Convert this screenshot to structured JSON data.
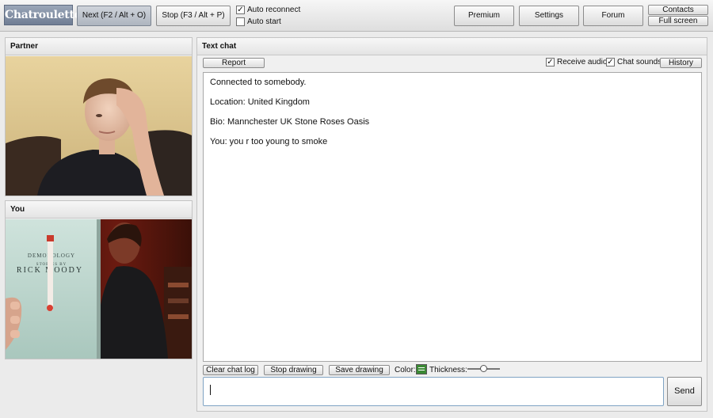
{
  "app": {
    "logo": "Chatroulette"
  },
  "toolbar": {
    "next_label": "Next (F2 / Alt + O)",
    "stop_label": "Stop (F3 / Alt + P)",
    "auto_reconnect": {
      "label": "Auto reconnect",
      "checked": true
    },
    "auto_start": {
      "label": "Auto start",
      "checked": false
    },
    "premium_label": "Premium",
    "settings_label": "Settings",
    "forum_label": "Forum",
    "contacts_label": "Contacts",
    "fullscreen_label": "Full screen"
  },
  "partner_panel": {
    "title": "Partner"
  },
  "you_panel": {
    "title": "You",
    "book": {
      "line1": "DEMONOLOGY",
      "line2": "STORIES BY",
      "author": "RICK MOODY"
    }
  },
  "text_chat": {
    "title": "Text chat",
    "report_label": "Report",
    "receive_audio": {
      "label": "Receive audio",
      "checked": true
    },
    "chat_sounds": {
      "label": "Chat sounds",
      "checked": true
    },
    "history_label": "History",
    "messages": [
      "Connected to somebody.",
      "Location: United Kingdom",
      "Bio: Mannchester UK Stone Roses Oasis",
      "You: you r too young to smoke"
    ],
    "clear_label": "Clear chat log",
    "stop_drawing_label": "Stop drawing",
    "save_drawing_label": "Save drawing",
    "color_label": "Color:",
    "thickness_label": "Thickness:",
    "thickness_value": 0.5,
    "input_value": "",
    "send_label": "Send"
  },
  "colors": {
    "logo_bg": "#7f8ca2",
    "accent_green": "#3b8a35",
    "input_border": "#7fa3c4"
  }
}
